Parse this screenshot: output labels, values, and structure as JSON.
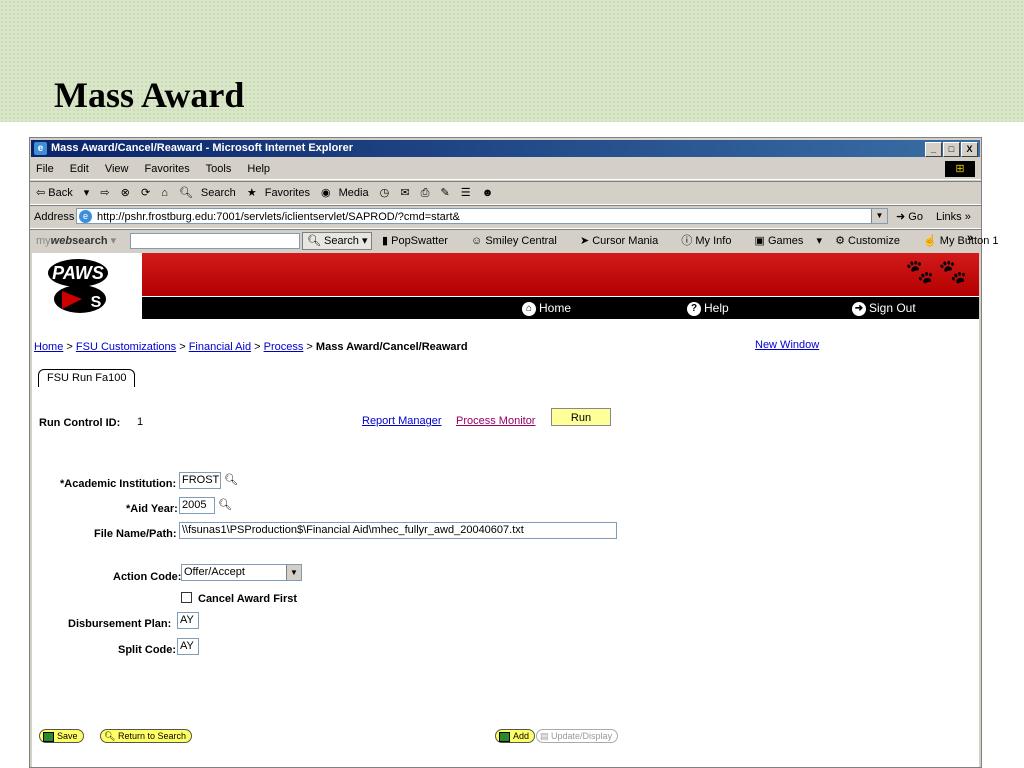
{
  "slide": {
    "title": "Mass Award"
  },
  "window": {
    "title": "Mass Award/Cancel/Reaward - Microsoft Internet Explorer",
    "controls": [
      "_",
      "□",
      "X"
    ]
  },
  "menu": [
    "File",
    "Edit",
    "View",
    "Favorites",
    "Tools",
    "Help"
  ],
  "toolbar": {
    "back": "⇦ Back",
    "forward": "⇨",
    "search": "Search",
    "favorites": "Favorites",
    "media": "Media"
  },
  "address": {
    "label": "Address",
    "url": "http://pshr.frostburg.edu:7001/servlets/iclientservlet/SAPROD/?cmd=start&",
    "go": "Go",
    "links": "Links"
  },
  "search_toolbar": {
    "brand_prefix": "my",
    "brand_web": "web",
    "brand_suffix": "search",
    "search_button": "Search",
    "items": [
      "PopSwatter",
      "Smiley Central",
      "Cursor Mania",
      "My Info",
      "Games",
      "Customize",
      "My Button 1"
    ]
  },
  "header": {
    "logo_text": "PAWS",
    "nav": {
      "home": "Home",
      "help": "Help",
      "signout": "Sign Out"
    }
  },
  "breadcrumb": {
    "items": [
      "Home",
      "FSU Customizations",
      "Financial Aid",
      "Process"
    ],
    "current": "Mass Award/Cancel/Reaward",
    "new_window": "New Window"
  },
  "tab": {
    "label": "FSU Run Fa100"
  },
  "run_control": {
    "label": "Run Control ID:",
    "value": "1",
    "report_manager": "Report Manager",
    "process_monitor": "Process Monitor",
    "run": "Run"
  },
  "form": {
    "institution_label": "*Academic Institution:",
    "institution_value": "FROST",
    "aid_year_label": "*Aid Year:",
    "aid_year_value": "2005",
    "file_label": "File Name/Path:",
    "file_value": "\\\\fsunas1\\PSProduction$\\Financial Aid\\mhec_fullyr_awd_20040607.txt",
    "action_label": "Action Code:",
    "action_value": "Offer/Accept",
    "cancel_label": "Cancel Award First",
    "disb_label": "Disbursement Plan:",
    "disb_value": "AY",
    "split_label": "Split Code:",
    "split_value": "AY"
  },
  "footer": {
    "save": "Save",
    "return": "Return to Search",
    "add": "Add",
    "update": "Update/Display"
  },
  "colors": {
    "link": "#0000cc",
    "visited": "#990066",
    "banner_red": "#cc0000",
    "run_button": "#ffff99"
  }
}
